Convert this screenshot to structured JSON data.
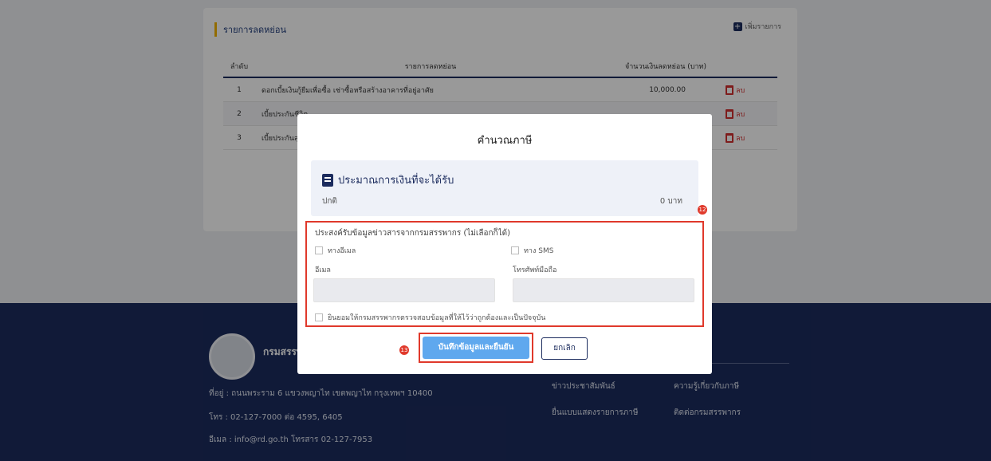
{
  "card": {
    "title": "รายการลดหย่อน",
    "add_label": "เพิ่มรายการ"
  },
  "table": {
    "headers": [
      "ลำดับ",
      "รายการลดหย่อน",
      "จำนวนเงินลดหย่อน (บาท)"
    ],
    "rows": [
      {
        "no": "1",
        "desc": "ดอกเบี้ยเงินกู้ยืมเพื่อซื้อ เช่าซื้อหรือสร้างอาคารที่อยู่อาศัย",
        "amount": "10,000.00",
        "delete": "ลบ"
      },
      {
        "no": "2",
        "desc": "เบี้ยประกันชีวิต",
        "amount": "",
        "delete": "ลบ"
      },
      {
        "no": "3",
        "desc": "เบี้ยประกันสุขภาพ",
        "amount": "",
        "delete": "ลบ"
      }
    ]
  },
  "footer": {
    "org_name": "กรมสรรพากร",
    "address": "ที่อยู่ : ถนนพระราม 6 แขวงพญาไท เขตพญาไท กรุงเทพฯ 10400",
    "phone": "โทร : 02-127-7000 ต่อ 4595, 6405",
    "email": "อีเมล : info@rd.go.th โทรสาร 02-127-7953",
    "links": [
      "ข่าวประชาสัมพันธ์",
      "ความรู้เกี่ยวกับภาษี",
      "ยื่นแบบแสดงรายการภาษี",
      "ติดต่อกรมสรรพากร"
    ]
  },
  "modal": {
    "title": "คำนวณภาษี",
    "summary_title": "ประมาณการเงินที่จะได้รับ",
    "summary_label": "ปกติ",
    "summary_value": "0 บาท",
    "badge_notify": "12",
    "badge_save": "13",
    "notify_title": "ประสงค์รับข้อมูลข่าวสารจากกรมสรรพากร (ไม่เลือกก็ได้)",
    "option_email": "ทางอีเมล",
    "option_sms": "ทาง SMS",
    "email_label": "อีเมล",
    "phone_label": "โทรศัพท์มือถือ",
    "email_value": "",
    "phone_value": "",
    "consent_text": "ยินยอมให้กรมสรรพากรตรวจสอบข้อมูลที่ให้ไว้ว่าถูกต้องและเป็นปัจจุบัน",
    "save_label": "บันทึกข้อมูลและยืนยัน",
    "cancel_label": "ยกเลิก"
  },
  "colors": {
    "navy": "#1c2c5e",
    "accent_blue": "#5fa8ee",
    "highlight_red": "#e0392b",
    "summary_bg": "#eef1f8"
  }
}
